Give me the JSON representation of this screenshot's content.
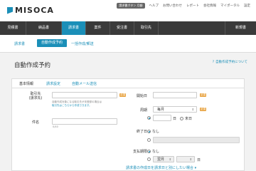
{
  "brand": {
    "name": "MISOCA"
  },
  "util": {
    "badge": "請求書ボタン 月額",
    "help": "ヘルプ",
    "contact": "お問い合わせ",
    "report": "レポート",
    "company": "会社情報",
    "mypage": "マイポータル",
    "settings": "設定"
  },
  "nav": {
    "items": [
      "見積書",
      "納品書",
      "請求書",
      "案件",
      "受注書",
      "取引先"
    ],
    "active_index": 2,
    "new_label": "新規書"
  },
  "subnav": {
    "invoice": "請求書",
    "auto": "自動作成予約",
    "bulk": "一括作成/郵送"
  },
  "page": {
    "title": "自動作成予約",
    "help_link": "自動作成予約について"
  },
  "tabs": [
    "基本情報",
    "請求設定",
    "自動メール送信"
  ],
  "form": {
    "client_label": "取引先\n(請求先)",
    "client_hint_1": "自動作成対象になる取引先が未登録の場合は",
    "client_hint_2": "取引先はこちらから作成できます。",
    "required": "必須",
    "subject_label": "件名",
    "subject_count": "0/40",
    "start_label": "開始日",
    "cycle_label": "周期",
    "cycle_value": "毎月",
    "day_option": "日",
    "end_option": "末日",
    "end_label": "終了日",
    "none": "なし",
    "pay_label": "支払期限",
    "pay_value": "翌月",
    "pay_day": "日",
    "more_link": "請求書の作成日を請求日と別にしたい場合 ▾"
  },
  "colors": {
    "accent": "#1b8fb8",
    "nav_bg": "#3a3a3a",
    "required": "#e8a443"
  }
}
